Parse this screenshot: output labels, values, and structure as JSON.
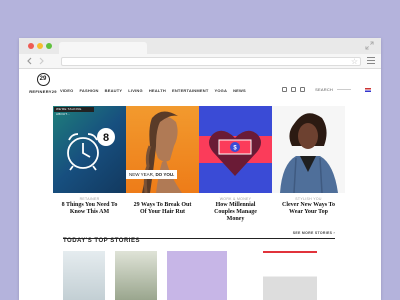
{
  "browser": {
    "window_controls": [
      "close",
      "minimize",
      "maximize"
    ],
    "url": ""
  },
  "site": {
    "logo_mark": "29",
    "logo_text": "REFINERY29",
    "nav": [
      "VIDEO",
      "FASHION",
      "BEAUTY",
      "LIVING",
      "HEALTH",
      "ENTERTAINMENT",
      "YOGA",
      "NEWS"
    ],
    "search_label": "SEARCH"
  },
  "cards": [
    {
      "badge": "WE'RE TALKING ABOUT...",
      "category": "RETAINER",
      "title": "8 Things You Need To Know This AM",
      "image": "teal-alarm-clock-with-8-badge"
    },
    {
      "label_prefix": "NEW YEAR, ",
      "label_bold": "DO YOU.",
      "category": "",
      "title": "29 Ways To Break Out Of Your Hair Rut",
      "image": "woman-with-braided-hair-on-orange"
    },
    {
      "category": "WORK & MONEY",
      "title": "How Millennial Couples Manage Money",
      "image": "heart-with-dollar-bill"
    },
    {
      "category": "STYLISH YOU",
      "title": "Clever New Ways To Wear Your Top",
      "image": "woman-in-denim-jacket"
    }
  ],
  "section": {
    "title": "TODAY'S TOP STORIES",
    "see_more": "SEE MORE STORIES ›"
  },
  "colors": {
    "background": "#b4b3dc",
    "accent_teal": "#1e7f7a",
    "accent_orange": "#ee7c18",
    "accent_red": "#fb3c5a",
    "accent_blue": "#3a4bd6"
  }
}
